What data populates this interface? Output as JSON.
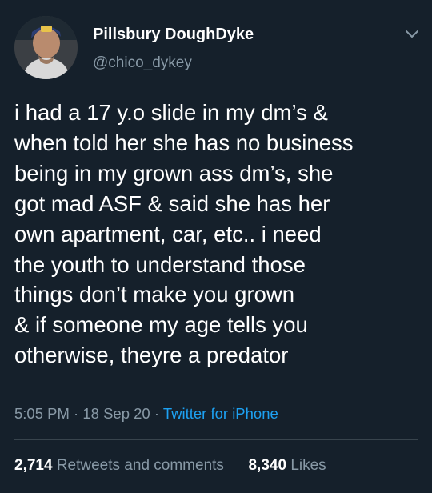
{
  "user": {
    "display_name": "Pillsbury DoughDyke",
    "handle": "@chico_dykey"
  },
  "tweet": {
    "text": "i had a 17 y.o slide in my dm’s &\nwhen told her she has no business\nbeing in my grown ass dm’s, she\ngot mad ASF & said she has her\nown apartment, car, etc.. i need\nthe youth to understand those\nthings don’t make you grown\n& if someone my age tells you\notherwise, theyre a predator",
    "time": "5:05 PM",
    "date": "18 Sep 20",
    "source": "Twitter for iPhone",
    "separator": "·"
  },
  "stats": {
    "retweets_count": "2,714",
    "retweets_label": "Retweets and comments",
    "likes_count": "8,340",
    "likes_label": "Likes"
  },
  "icons": {
    "menu": "chevron-down-icon",
    "avatar": "profile-photo"
  },
  "colors": {
    "background": "#15202b",
    "secondary_text": "#8899a6",
    "link": "#1da1f2",
    "divider": "#38444d"
  }
}
